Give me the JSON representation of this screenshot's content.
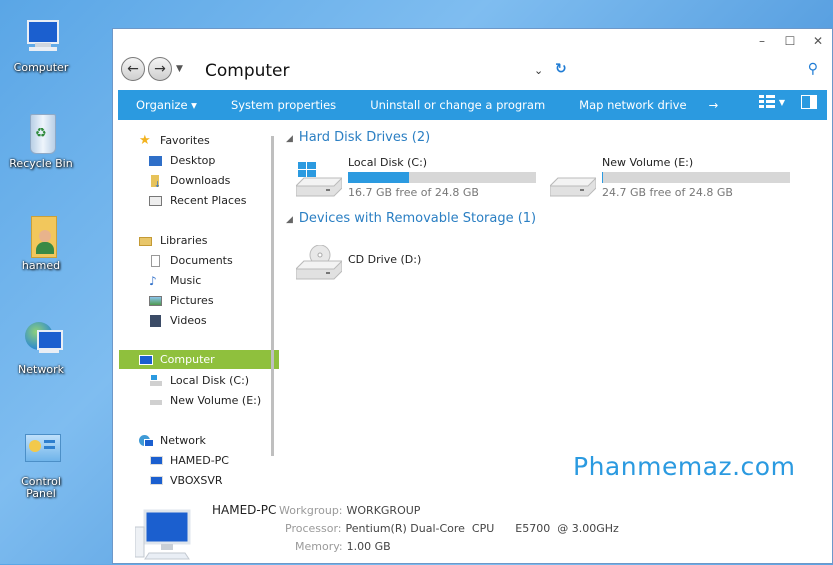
{
  "desktop": {
    "icons": [
      {
        "label": "Computer"
      },
      {
        "label": "Recycle Bin"
      },
      {
        "label": "hamed"
      },
      {
        "label": "Network"
      },
      {
        "label": "Control Panel"
      }
    ]
  },
  "window": {
    "controls": {
      "minimize": "–",
      "maximize": "☐",
      "close": "✕"
    },
    "address": {
      "title": "Computer",
      "caret": "⌄",
      "refresh": "↻",
      "search": "⚲"
    },
    "commandbar": {
      "items": [
        "Organize ▾",
        "System properties",
        "Uninstall or change a program",
        "Map network drive",
        "→"
      ]
    },
    "nav": {
      "favorites": {
        "label": "Favorites",
        "items": [
          "Desktop",
          "Downloads",
          "Recent Places"
        ]
      },
      "libraries": {
        "label": "Libraries",
        "items": [
          "Documents",
          "Music",
          "Pictures",
          "Videos"
        ]
      },
      "computer": {
        "label": "Computer",
        "items": [
          "Local Disk (C:)",
          "New Volume (E:)"
        ]
      },
      "network": {
        "label": "Network",
        "items": [
          "HAMED-PC",
          "VBOXSVR"
        ]
      }
    },
    "content": {
      "hdd_group": "Hard Disk Drives (2)",
      "removable_group": "Devices with Removable Storage (1)",
      "drives": [
        {
          "name": "Local Disk (C:)",
          "free": "16.7 GB free of 24.8 GB",
          "used_fraction": 0.327
        },
        {
          "name": "New Volume (E:)",
          "free": "24.7 GB free of 24.8 GB",
          "used_fraction": 0.004
        }
      ],
      "cd": {
        "name": "CD Drive (D:)"
      }
    },
    "watermark": "Phanmemaz.com",
    "details": {
      "pc_name": "HAMED-PC",
      "workgroup_label": "Workgroup:",
      "workgroup": "WORKGROUP",
      "processor_label": "Processor:",
      "processor": "Pentium(R) Dual-Core  CPU      E5700  @ 3.00GHz",
      "memory_label": "Memory:",
      "memory": "1.00 GB"
    }
  },
  "colors": {
    "accent": "#2b9ae0",
    "selected": "#8fc03d",
    "group_text": "#2b7fc3"
  }
}
